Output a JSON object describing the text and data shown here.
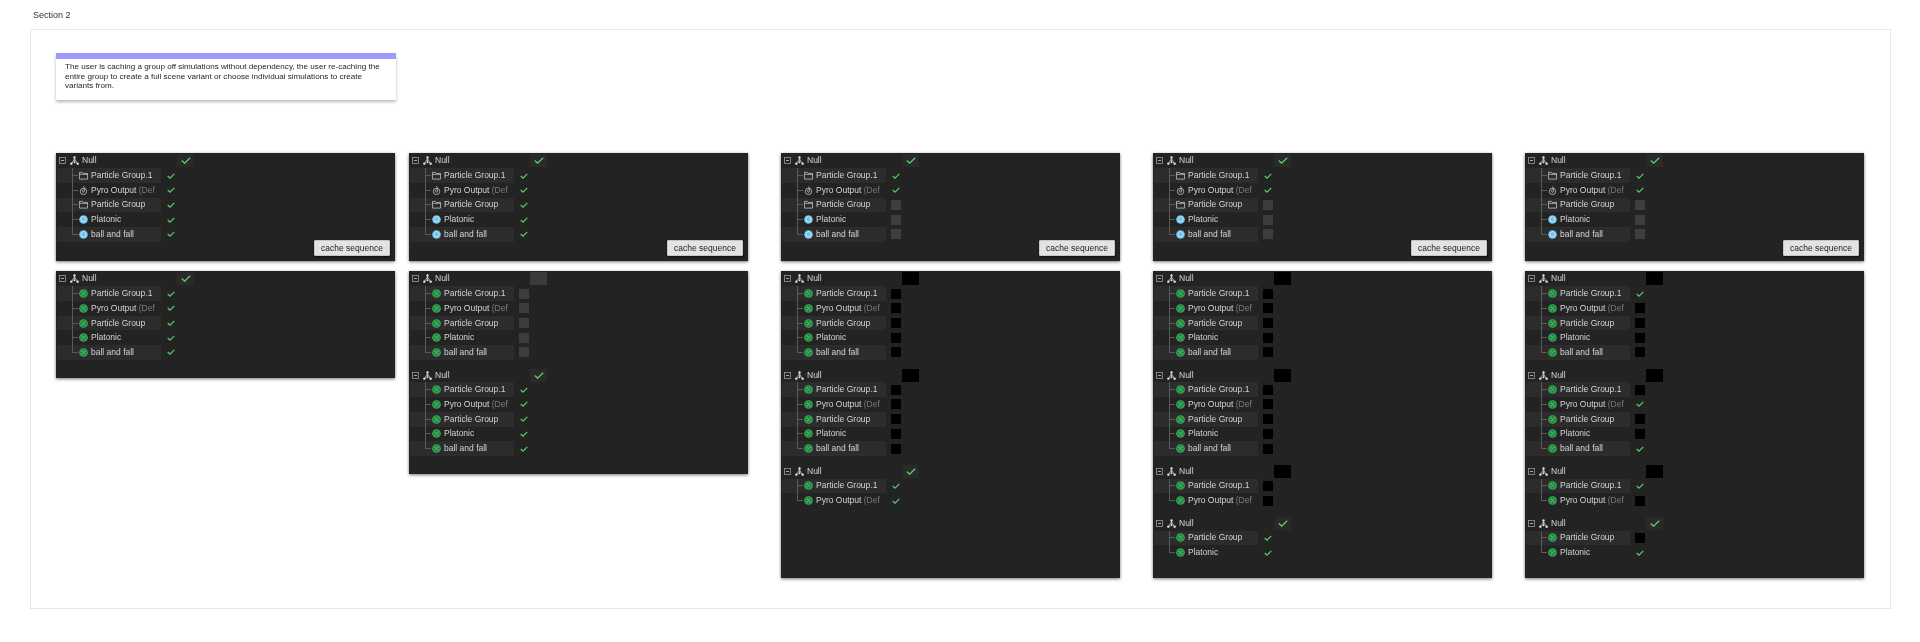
{
  "section": {
    "title": "Section 2"
  },
  "note": {
    "text": "The user is caching a group off simulations without dependency, the user re-caching the entire group to create a full scene variant or choose individual simulations to create variants from."
  },
  "columns": [
    {
      "panels": [
        {
          "groups": [
            {
              "name": "Null",
              "expanded": true,
              "checked": true,
              "disabled": false,
              "items": [
                {
                  "kind": "folder",
                  "name": "Particle Group.1",
                  "checked": true,
                  "disabled": false
                },
                {
                  "kind": "emitter",
                  "name": "Pyro Output",
                  "suffix": "(Def",
                  "checked": true,
                  "disabled": false
                },
                {
                  "kind": "folder",
                  "name": "Particle Group",
                  "checked": true,
                  "disabled": false
                },
                {
                  "kind": "geometry",
                  "name": "Platonic",
                  "checked": true,
                  "disabled": false
                },
                {
                  "kind": "geometry",
                  "name": "ball and fall",
                  "checked": true,
                  "disabled": false
                }
              ]
            }
          ],
          "button": "cache sequence"
        },
        {
          "groups": [
            {
              "name": "Null",
              "expanded": true,
              "checked": true,
              "disabled": false,
              "items": [
                {
                  "kind": "cached",
                  "name": "Particle Group.1",
                  "checked": true,
                  "disabled": false
                },
                {
                  "kind": "cached",
                  "name": "Pyro Output",
                  "suffix": "(Def",
                  "checked": true,
                  "disabled": false
                },
                {
                  "kind": "cached",
                  "name": "Particle Group",
                  "checked": true,
                  "disabled": false
                },
                {
                  "kind": "cached",
                  "name": "Platonic",
                  "checked": true,
                  "disabled": false
                },
                {
                  "kind": "cached",
                  "name": "ball and fall",
                  "checked": true,
                  "disabled": false
                }
              ]
            }
          ]
        }
      ]
    },
    {
      "panels": [
        {
          "groups": [
            {
              "name": "Null",
              "expanded": true,
              "checked": true,
              "disabled": false,
              "items": [
                {
                  "kind": "folder",
                  "name": "Particle Group.1",
                  "checked": true,
                  "disabled": false
                },
                {
                  "kind": "emitter",
                  "name": "Pyro Output",
                  "suffix": "(Def",
                  "checked": true,
                  "disabled": false
                },
                {
                  "kind": "folder",
                  "name": "Particle Group",
                  "checked": true,
                  "disabled": false
                },
                {
                  "kind": "geometry",
                  "name": "Platonic",
                  "checked": true,
                  "disabled": false
                },
                {
                  "kind": "geometry",
                  "name": "ball and fall",
                  "checked": true,
                  "disabled": false
                }
              ]
            }
          ],
          "button": "cache sequence"
        },
        {
          "groups": [
            {
              "name": "Null",
              "expanded": true,
              "checked": false,
              "disabled": false,
              "items": [
                {
                  "kind": "cached",
                  "name": "Particle Group.1",
                  "checked": false,
                  "disabled": false
                },
                {
                  "kind": "cached",
                  "name": "Pyro Output",
                  "suffix": "(Def",
                  "checked": false,
                  "disabled": false
                },
                {
                  "kind": "cached",
                  "name": "Particle Group",
                  "checked": false,
                  "disabled": false
                },
                {
                  "kind": "cached",
                  "name": "Platonic",
                  "checked": false,
                  "disabled": false
                },
                {
                  "kind": "cached",
                  "name": "ball and fall",
                  "checked": false,
                  "disabled": false
                }
              ]
            },
            {
              "name": "Null",
              "expanded": true,
              "checked": true,
              "disabled": false,
              "items": [
                {
                  "kind": "cached",
                  "name": "Particle Group.1",
                  "checked": true,
                  "disabled": false
                },
                {
                  "kind": "cached",
                  "name": "Pyro Output",
                  "suffix": "(Def",
                  "checked": true,
                  "disabled": false
                },
                {
                  "kind": "cached",
                  "name": "Particle Group",
                  "checked": true,
                  "disabled": false
                },
                {
                  "kind": "cached",
                  "name": "Platonic",
                  "checked": true,
                  "disabled": false
                },
                {
                  "kind": "cached",
                  "name": "ball and fall",
                  "checked": true,
                  "disabled": false
                }
              ]
            }
          ]
        }
      ]
    },
    {
      "panels": [
        {
          "groups": [
            {
              "name": "Null",
              "expanded": true,
              "checked": true,
              "disabled": false,
              "items": [
                {
                  "kind": "folder",
                  "name": "Particle Group.1",
                  "checked": true,
                  "disabled": false
                },
                {
                  "kind": "emitter",
                  "name": "Pyro Output",
                  "suffix": "(Def",
                  "checked": true,
                  "disabled": false
                },
                {
                  "kind": "folder",
                  "name": "Particle Group",
                  "checked": false,
                  "disabled": false
                },
                {
                  "kind": "geometry",
                  "name": "Platonic",
                  "checked": false,
                  "disabled": false
                },
                {
                  "kind": "geometry",
                  "name": "ball and fall",
                  "checked": false,
                  "disabled": false
                }
              ]
            }
          ],
          "button": "cache sequence"
        },
        {
          "groups": [
            {
              "name": "Null",
              "expanded": true,
              "checked": false,
              "disabled": true,
              "items": [
                {
                  "kind": "cached",
                  "name": "Particle Group.1",
                  "checked": false,
                  "disabled": true
                },
                {
                  "kind": "cached",
                  "name": "Pyro Output",
                  "suffix": "(Def",
                  "checked": false,
                  "disabled": true
                },
                {
                  "kind": "cached",
                  "name": "Particle Group",
                  "checked": false,
                  "disabled": true
                },
                {
                  "kind": "cached",
                  "name": "Platonic",
                  "checked": false,
                  "disabled": true
                },
                {
                  "kind": "cached",
                  "name": "ball and fall",
                  "checked": false,
                  "disabled": true
                }
              ]
            },
            {
              "name": "Null",
              "expanded": true,
              "checked": false,
              "disabled": true,
              "items": [
                {
                  "kind": "cached",
                  "name": "Particle Group.1",
                  "checked": false,
                  "disabled": true
                },
                {
                  "kind": "cached",
                  "name": "Pyro Output",
                  "suffix": "(Def",
                  "checked": false,
                  "disabled": true
                },
                {
                  "kind": "cached",
                  "name": "Particle Group",
                  "checked": false,
                  "disabled": true
                },
                {
                  "kind": "cached",
                  "name": "Platonic",
                  "checked": false,
                  "disabled": true
                },
                {
                  "kind": "cached",
                  "name": "ball and fall",
                  "checked": false,
                  "disabled": true
                }
              ]
            },
            {
              "name": "Null",
              "expanded": true,
              "checked": true,
              "disabled": false,
              "items": [
                {
                  "kind": "cached",
                  "name": "Particle Group.1",
                  "checked": true,
                  "disabled": false
                },
                {
                  "kind": "cached",
                  "name": "Pyro Output",
                  "suffix": "(Def",
                  "checked": true,
                  "disabled": false
                }
              ]
            }
          ]
        }
      ]
    },
    {
      "panels": [
        {
          "groups": [
            {
              "name": "Null",
              "expanded": true,
              "checked": true,
              "disabled": false,
              "items": [
                {
                  "kind": "folder",
                  "name": "Particle Group.1",
                  "checked": true,
                  "disabled": false
                },
                {
                  "kind": "emitter",
                  "name": "Pyro Output",
                  "suffix": "(Def",
                  "checked": true,
                  "disabled": false
                },
                {
                  "kind": "folder",
                  "name": "Particle Group",
                  "checked": false,
                  "disabled": false
                },
                {
                  "kind": "geometry",
                  "name": "Platonic",
                  "checked": false,
                  "disabled": false
                },
                {
                  "kind": "geometry",
                  "name": "ball and fall",
                  "checked": false,
                  "disabled": false
                }
              ]
            }
          ],
          "button": "cache sequence"
        },
        {
          "groups": [
            {
              "name": "Null",
              "expanded": true,
              "checked": false,
              "disabled": true,
              "items": [
                {
                  "kind": "cached",
                  "name": "Particle Group.1",
                  "checked": false,
                  "disabled": true
                },
                {
                  "kind": "cached",
                  "name": "Pyro Output",
                  "suffix": "(Def",
                  "checked": false,
                  "disabled": true
                },
                {
                  "kind": "cached",
                  "name": "Particle Group",
                  "checked": false,
                  "disabled": true
                },
                {
                  "kind": "cached",
                  "name": "Platonic",
                  "checked": false,
                  "disabled": true
                },
                {
                  "kind": "cached",
                  "name": "ball and fall",
                  "checked": false,
                  "disabled": true
                }
              ]
            },
            {
              "name": "Null",
              "expanded": true,
              "checked": false,
              "disabled": true,
              "items": [
                {
                  "kind": "cached",
                  "name": "Particle Group.1",
                  "checked": false,
                  "disabled": true
                },
                {
                  "kind": "cached",
                  "name": "Pyro Output",
                  "suffix": "(Def",
                  "checked": false,
                  "disabled": true
                },
                {
                  "kind": "cached",
                  "name": "Particle Group",
                  "checked": false,
                  "disabled": true
                },
                {
                  "kind": "cached",
                  "name": "Platonic",
                  "checked": false,
                  "disabled": true
                },
                {
                  "kind": "cached",
                  "name": "ball and fall",
                  "checked": false,
                  "disabled": true
                }
              ]
            },
            {
              "name": "Null",
              "expanded": true,
              "checked": false,
              "disabled": true,
              "items": [
                {
                  "kind": "cached",
                  "name": "Particle Group.1",
                  "checked": false,
                  "disabled": true
                },
                {
                  "kind": "cached",
                  "name": "Pyro Output",
                  "suffix": "(Def",
                  "checked": false,
                  "disabled": true
                }
              ]
            },
            {
              "name": "Null",
              "expanded": true,
              "checked": true,
              "disabled": false,
              "items": [
                {
                  "kind": "cached",
                  "name": "Particle Group",
                  "checked": true,
                  "disabled": false
                },
                {
                  "kind": "cached",
                  "name": "Platonic",
                  "checked": true,
                  "disabled": false
                }
              ]
            }
          ]
        }
      ]
    },
    {
      "panels": [
        {
          "groups": [
            {
              "name": "Null",
              "expanded": true,
              "checked": true,
              "disabled": false,
              "items": [
                {
                  "kind": "folder",
                  "name": "Particle Group.1",
                  "checked": true,
                  "disabled": false
                },
                {
                  "kind": "emitter",
                  "name": "Pyro Output",
                  "suffix": "(Def",
                  "checked": true,
                  "disabled": false
                },
                {
                  "kind": "folder",
                  "name": "Particle Group",
                  "checked": false,
                  "disabled": false
                },
                {
                  "kind": "geometry",
                  "name": "Platonic",
                  "checked": false,
                  "disabled": false
                },
                {
                  "kind": "geometry",
                  "name": "ball and fall",
                  "checked": false,
                  "disabled": false
                }
              ]
            }
          ],
          "button": "cache sequence"
        },
        {
          "groups": [
            {
              "name": "Null",
              "expanded": true,
              "checked": false,
              "disabled": true,
              "items": [
                {
                  "kind": "cached",
                  "name": "Particle Group.1",
                  "checked": true,
                  "disabled": false
                },
                {
                  "kind": "cached",
                  "name": "Pyro Output",
                  "suffix": "(Def",
                  "checked": false,
                  "disabled": true
                },
                {
                  "kind": "cached",
                  "name": "Particle Group",
                  "checked": false,
                  "disabled": true
                },
                {
                  "kind": "cached",
                  "name": "Platonic",
                  "checked": false,
                  "disabled": true
                },
                {
                  "kind": "cached",
                  "name": "ball and fall",
                  "checked": false,
                  "disabled": true
                }
              ]
            },
            {
              "name": "Null",
              "expanded": true,
              "checked": false,
              "disabled": true,
              "items": [
                {
                  "kind": "cached",
                  "name": "Particle Group.1",
                  "checked": false,
                  "disabled": true
                },
                {
                  "kind": "cached",
                  "name": "Pyro Output",
                  "suffix": "(Def",
                  "checked": true,
                  "disabled": false
                },
                {
                  "kind": "cached",
                  "name": "Particle Group",
                  "checked": false,
                  "disabled": true
                },
                {
                  "kind": "cached",
                  "name": "Platonic",
                  "checked": false,
                  "disabled": true
                },
                {
                  "kind": "cached",
                  "name": "ball and fall",
                  "checked": true,
                  "disabled": false
                }
              ]
            },
            {
              "name": "Null",
              "expanded": true,
              "checked": false,
              "disabled": true,
              "items": [
                {
                  "kind": "cached",
                  "name": "Particle Group.1",
                  "checked": true,
                  "disabled": false
                },
                {
                  "kind": "cached",
                  "name": "Pyro Output",
                  "suffix": "(Def",
                  "checked": false,
                  "disabled": true
                }
              ]
            },
            {
              "name": "Null",
              "expanded": true,
              "checked": true,
              "disabled": false,
              "items": [
                {
                  "kind": "cached",
                  "name": "Particle Group",
                  "checked": false,
                  "disabled": true
                },
                {
                  "kind": "cached",
                  "name": "Platonic",
                  "checked": true,
                  "disabled": false
                }
              ]
            }
          ]
        }
      ]
    }
  ]
}
